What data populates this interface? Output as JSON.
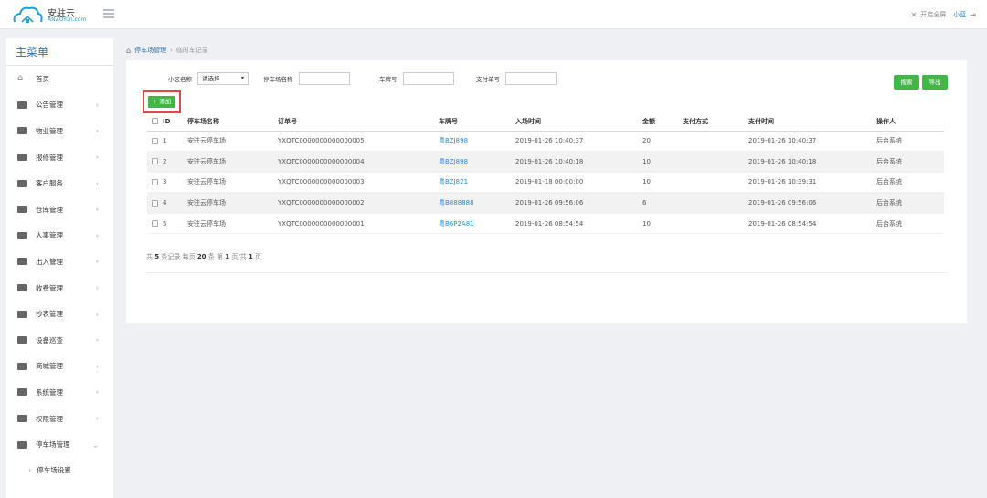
{
  "header": {
    "logo_cn": "安驻云",
    "logo_en": "ANZOYun.com",
    "fullscreen_label": "开启全屏",
    "user_name": "小蓝",
    "logout_icon": "logout-icon"
  },
  "sidebar": {
    "title": "主菜单",
    "items": [
      {
        "label": "首页",
        "icon": "home-icon"
      },
      {
        "label": "公告管理",
        "icon": "folder-icon"
      },
      {
        "label": "物业管理",
        "icon": "folder-icon"
      },
      {
        "label": "报修管理",
        "icon": "folder-icon"
      },
      {
        "label": "客户服务",
        "icon": "folder-icon"
      },
      {
        "label": "仓库管理",
        "icon": "folder-icon"
      },
      {
        "label": "人事管理",
        "icon": "folder-icon"
      },
      {
        "label": "出入管理",
        "icon": "folder-icon"
      },
      {
        "label": "收费管理",
        "icon": "folder-icon"
      },
      {
        "label": "抄表管理",
        "icon": "folder-icon"
      },
      {
        "label": "设备巡查",
        "icon": "folder-icon"
      },
      {
        "label": "商城管理",
        "icon": "folder-icon"
      },
      {
        "label": "系统管理",
        "icon": "folder-icon"
      },
      {
        "label": "权限管理",
        "icon": "folder-icon"
      },
      {
        "label": "停车场管理",
        "icon": "folder-icon"
      }
    ],
    "sub_item": "停车场设置"
  },
  "breadcrumb": {
    "level1": "停车场管理",
    "level2": "临时车记录"
  },
  "filters": {
    "community_label": "小区名称",
    "community_value": "请选择",
    "parking_label": "停车场名称",
    "plate_label": "车牌号",
    "payno_label": "支付单号"
  },
  "actions": {
    "search": "搜索",
    "export": "导出",
    "add": "+ 添加"
  },
  "table": {
    "headers": [
      "ID",
      "停车场名称",
      "订单号",
      "车牌号",
      "入场时间",
      "金额",
      "支付方式",
      "支付时间",
      "操作人"
    ],
    "rows": [
      {
        "id": "1",
        "name": "安驻云停车场",
        "order": "YXQTC0000000000000005",
        "plate": "粤BZJ898",
        "in_time": "2019-01-26 10:40:37",
        "amount": "20",
        "pay_method": "",
        "pay_time": "2019-01-26 10:40:37",
        "operator": "后台系统"
      },
      {
        "id": "2",
        "name": "安驻云停车场",
        "order": "YXQTC0000000000000004",
        "plate": "粤BZJ898",
        "in_time": "2019-01-26 10:40:18",
        "amount": "10",
        "pay_method": "",
        "pay_time": "2019-01-26 10:40:18",
        "operator": "后台系统"
      },
      {
        "id": "3",
        "name": "安驻云停车场",
        "order": "YXQTC0000000000000003",
        "plate": "粤BZJ821",
        "in_time": "2019-01-18 00:00:00",
        "amount": "10",
        "pay_method": "",
        "pay_time": "2019-01-26 10:39:31",
        "operator": "后台系统"
      },
      {
        "id": "4",
        "name": "安驻云停车场",
        "order": "YXQTC0000000000000002",
        "plate": "粤B888888",
        "in_time": "2019-01-26 09:56:06",
        "amount": "6",
        "pay_method": "",
        "pay_time": "2019-01-26 09:56:06",
        "operator": "后台系统"
      },
      {
        "id": "5",
        "name": "安驻云停车场",
        "order": "YXQTC0000000000000001",
        "plate": "粤B6P2A81",
        "in_time": "2019-01-26 08:54:54",
        "amount": "10",
        "pay_method": "",
        "pay_time": "2019-01-26 08:54:54",
        "operator": "后台系统"
      }
    ]
  },
  "pager": {
    "p1": "共",
    "total": "5",
    "p2": "条记录 每页",
    "per_page": "20",
    "p3": "条 第",
    "current": "1",
    "p4": "页/共",
    "pages": "1",
    "p5": "页"
  },
  "colors": {
    "accent_green": "#43b648",
    "link_blue": "#2a8bd0",
    "highlight_red": "#e04848"
  }
}
